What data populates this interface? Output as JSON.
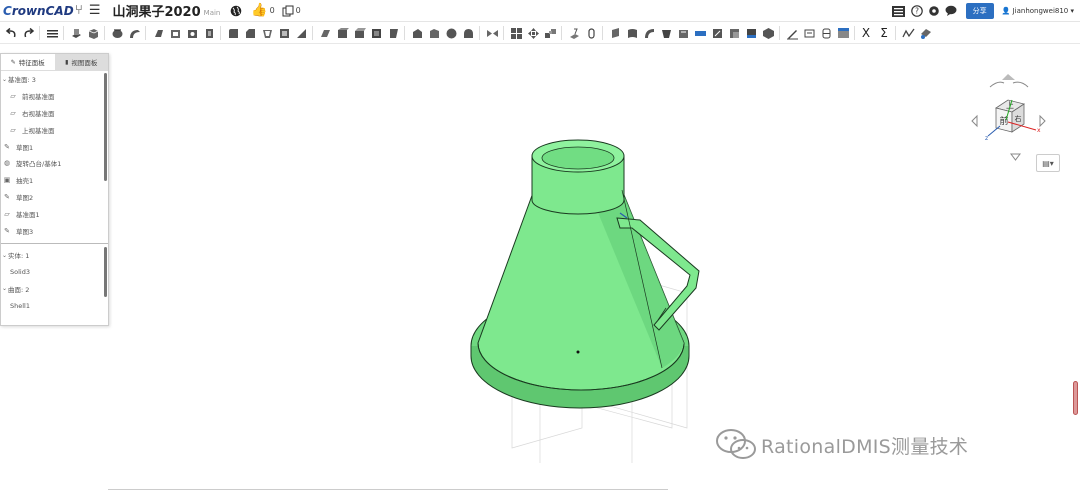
{
  "app": {
    "logo": "CrownCAD",
    "project_title": "山洞果子2020",
    "branch": "Main",
    "likes": "0",
    "copies": "0",
    "share_label": "分享",
    "username": "Jianhongwei810 ▾"
  },
  "toolbar": {
    "symbols": {
      "x": "X",
      "sigma": "Σ"
    }
  },
  "panel": {
    "tabs": [
      {
        "label": "特征面板",
        "icon": "edit-icon",
        "active": true
      },
      {
        "label": "视图面板",
        "icon": "book-icon",
        "active": false
      }
    ],
    "tree": [
      {
        "label": "基准面: 3",
        "type": "group"
      },
      {
        "label": "前视基准面",
        "type": "plane"
      },
      {
        "label": "右视基准面",
        "type": "plane"
      },
      {
        "label": "上视基准面",
        "type": "plane"
      },
      {
        "label": "草图1",
        "type": "sketch"
      },
      {
        "label": "旋转凸台/基体1",
        "type": "revolve"
      },
      {
        "label": "抽壳1",
        "type": "shell"
      },
      {
        "label": "草图2",
        "type": "sketch"
      },
      {
        "label": "基准面1",
        "type": "plane"
      },
      {
        "label": "草图3",
        "type": "sketch"
      }
    ],
    "bodies": [
      {
        "label": "实体: 1",
        "type": "group"
      },
      {
        "label": "Solid3",
        "type": "item"
      },
      {
        "label": "曲面: 2",
        "type": "group"
      },
      {
        "label": "Shell1",
        "type": "item"
      }
    ]
  },
  "navcube": {
    "front": "前",
    "top": "上",
    "right": "右"
  },
  "watermark": "RationalDMIS测量技术",
  "colors": {
    "model_fill": "#7ee88e",
    "model_edge": "#1a3a20",
    "share_button": "#2c6fc1",
    "logo": "#1f3a80"
  }
}
